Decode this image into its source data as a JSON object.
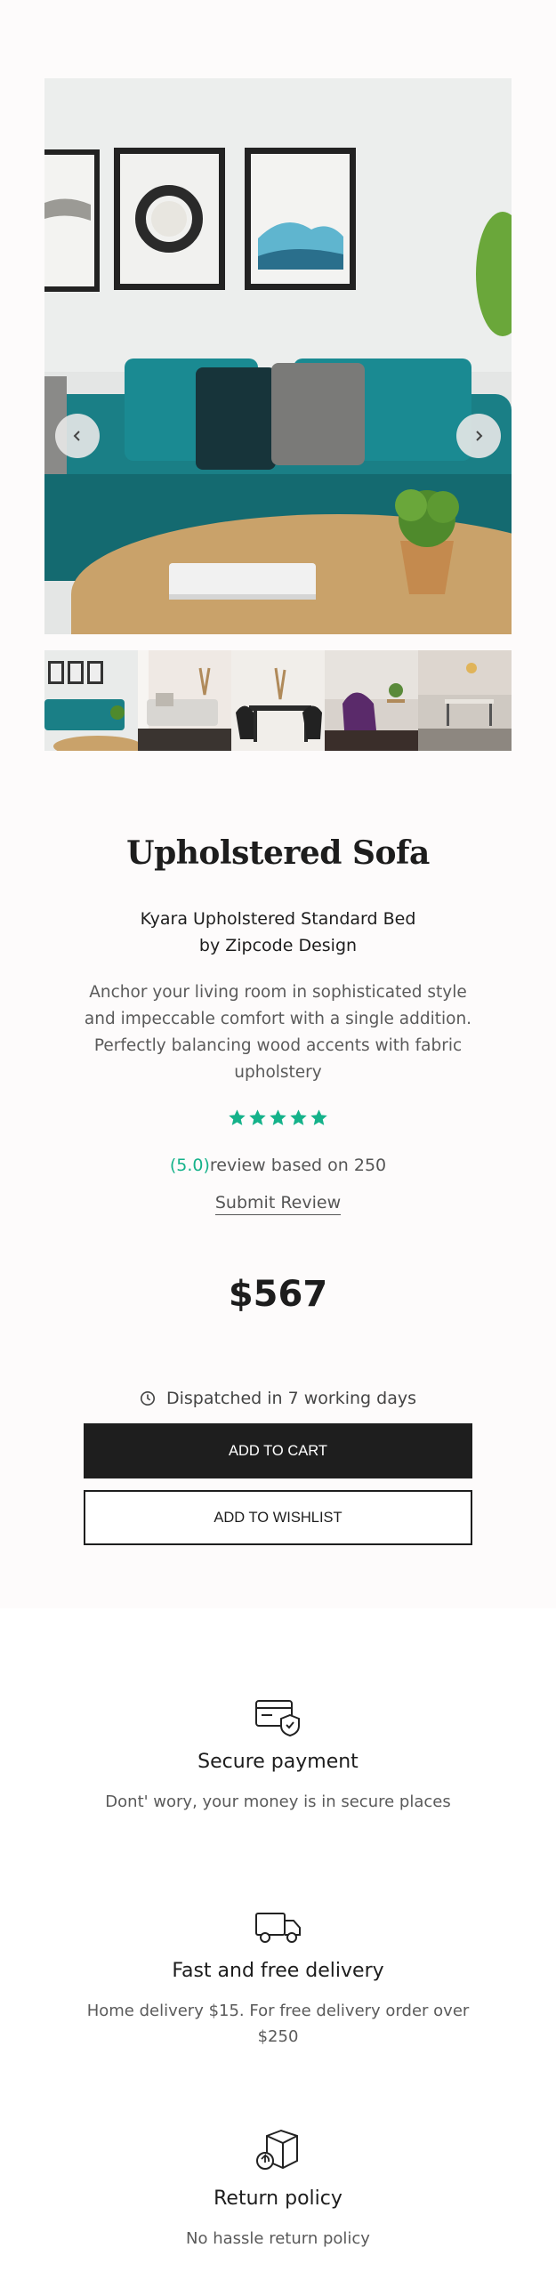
{
  "gallery": {
    "prev_icon": "chevron-left-icon",
    "next_icon": "chevron-right-icon",
    "thumbnails": [
      "teal-sofa-living-room",
      "white-sofa-living-room",
      "dining-table-black-chairs",
      "purple-armchair",
      "cafe-dining-area"
    ]
  },
  "product": {
    "title": "Upholstered Sofa",
    "subtitle_line1": "Kyara Upholstered Standard Bed",
    "subtitle_line2": "by Zipcode Design",
    "description": "Anchor your living room in sophisticated style and impeccable comfort with a single addition. Perfectly balancing wood accents with fabric upholstery",
    "stars": 5,
    "rating_score": "(5.0)",
    "rating_text": "review based on 250",
    "submit_review": "Submit Review",
    "price": "$567",
    "dispatch": "Dispatched in 7 working days",
    "add_to_cart": "ADD TO CART",
    "add_to_wishlist": "ADD TO WISHLIST"
  },
  "features": [
    {
      "icon": "credit-card-shield-icon",
      "title": "Secure payment",
      "text": "Dont' wory, your money is in secure places"
    },
    {
      "icon": "delivery-truck-icon",
      "title": "Fast and free delivery",
      "text": "Home delivery $15. For free delivery order over $250"
    },
    {
      "icon": "return-box-icon",
      "title": "Return policy",
      "text": "No hassle return policy"
    }
  ],
  "colors": {
    "accent": "#15b28a",
    "dark": "#1e1e1e",
    "sofa": "#1b7d84"
  }
}
